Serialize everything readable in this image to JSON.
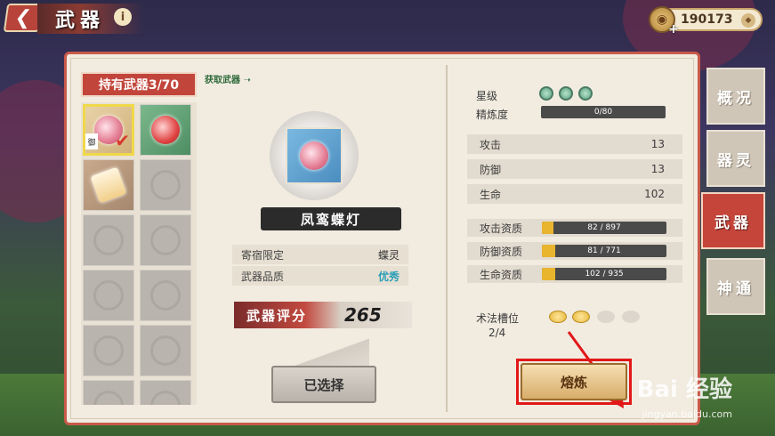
{
  "header": {
    "title": "武器",
    "info_icon": "info-icon",
    "currency_value": "190173",
    "currency_icon": "coin-icon"
  },
  "left": {
    "owned_label": "持有武器3/70",
    "get_weapon_label": "获取武器",
    "slots": [
      {
        "state": "lantern-selected",
        "tag": "御"
      },
      {
        "state": "lantern-red"
      },
      {
        "state": "scroll"
      },
      {
        "state": "empty"
      }
    ]
  },
  "center": {
    "weapon_name": "凤鸾蝶灯",
    "host_limit_label": "寄宿限定",
    "host_limit_value": "蝶灵",
    "quality_label": "武器品质",
    "quality_value": "优秀",
    "score_label": "武器评分",
    "score_value": "265",
    "select_button": "已选择"
  },
  "right": {
    "star_label": "星级",
    "stars": 3,
    "refine_label": "精炼度",
    "refine_value": "0/80",
    "stats": [
      {
        "label": "攻击",
        "value": "13"
      },
      {
        "label": "防御",
        "value": "13"
      },
      {
        "label": "生命",
        "value": "102"
      }
    ],
    "aptitudes": [
      {
        "label": "攻击资质",
        "value": "82 / 897",
        "fill": 0.0914
      },
      {
        "label": "防御资质",
        "value": "81 / 771",
        "fill": 0.105
      },
      {
        "label": "生命资质",
        "value": "102 / 935",
        "fill": 0.109
      }
    ],
    "spell_slot_label": "术法槽位",
    "spell_slot_count": "2/4",
    "smelt_button": "熔炼"
  },
  "tabs": [
    {
      "label": "概况",
      "active": false
    },
    {
      "label": "器灵",
      "active": false
    },
    {
      "label": "武器",
      "active": true
    },
    {
      "label": "神通",
      "active": false
    }
  ],
  "watermark": {
    "brand": "Bai 经验",
    "url": "jingyan.baidu.com"
  },
  "colors": {
    "accent_red": "#c5453a",
    "panel_bg": "#f1ebe0",
    "quality_blue": "#2a9db8",
    "annotation_red": "#e21818",
    "aptitude_fill": "#e9b42e"
  }
}
